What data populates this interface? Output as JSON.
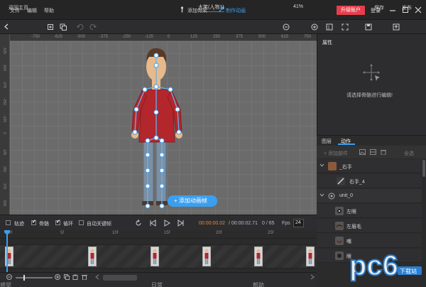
{
  "menu": {
    "file": "文件",
    "edit": "编辑",
    "help": "帮助"
  },
  "breadcrumb": {
    "step1": "添加骨架",
    "sep": "»",
    "step2": "制作动画"
  },
  "account": {
    "upgrade": "升级账户",
    "login": "登录"
  },
  "toolbar": {
    "back": "返回主页",
    "doc_title": "大笑(人物1)",
    "zoom": "41%",
    "save": "保存",
    "publish": "发布"
  },
  "ruler": {
    "top": [
      "-750",
      "-625",
      "-500",
      "-375",
      "-250",
      "-125",
      "0",
      "125",
      "250",
      "375",
      "500",
      "625",
      "750"
    ],
    "left": [
      "-625",
      "-500",
      "-375",
      "-250",
      "-125",
      "0",
      "125",
      "250",
      "375",
      "500"
    ]
  },
  "canvas": {
    "add_frame_button": "添加动画帧"
  },
  "properties": {
    "title": "属性",
    "hint": "请选择骨骼进行编辑!"
  },
  "tabs": {
    "layers": "图层",
    "animation": "动作"
  },
  "layer_toolbar": {
    "add_part": "+ 添加部件",
    "select_all": "全选"
  },
  "layers": [
    {
      "label": "_右手",
      "indent": 0
    },
    {
      "label": "右手_4",
      "indent": 1
    },
    {
      "label": "unit_0",
      "indent": 0
    },
    {
      "label": "左眼",
      "indent": 1
    },
    {
      "label": "左眉毛",
      "indent": 1
    },
    {
      "label": "嘴",
      "indent": 1
    },
    {
      "label": "眼",
      "indent": 1
    }
  ],
  "playback": {
    "track": "轨迹",
    "bones": "骨骼",
    "loop": "循环",
    "auto_key": "自动关键帧",
    "track_checked": false,
    "bones_checked": true,
    "loop_checked": true,
    "auto_key_checked": false,
    "time_current": "00:00:00.02",
    "time_total": "/ 00:00:02.71",
    "frame_current": "0",
    "frame_total": "/ 65",
    "fps_label": "Fps",
    "fps_value": "24"
  },
  "timeline": {
    "ticks": [
      "0f",
      "5f",
      "10f",
      "15f",
      "20f",
      "25f"
    ]
  },
  "footer_peek": {
    "a": "感觉",
    "b": "日常",
    "c": "帮助",
    "d": "推上"
  },
  "watermark": {
    "text": "pc6",
    "sub": "下载站"
  },
  "colors": {
    "accent": "#3b9ff0",
    "upgrade": "#e43f4c",
    "canvas": "#6b6b6b",
    "shirt": "#b3262b"
  }
}
